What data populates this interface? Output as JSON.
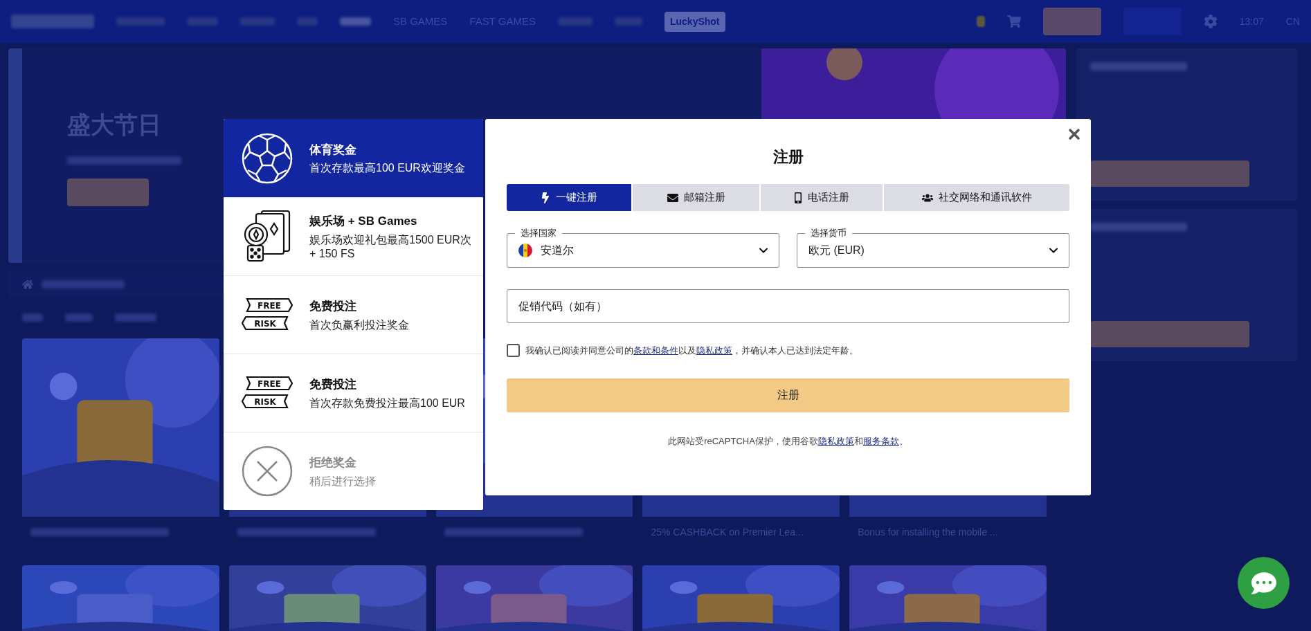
{
  "nav": {
    "items": [
      "SB GAMES",
      "FAST GAMES"
    ],
    "badge": "LuckyShot",
    "time": "13:07",
    "language": "CN"
  },
  "banner": {
    "title": "盛大节日"
  },
  "promo_cards": [
    {
      "kind": "blurred"
    },
    {
      "kind": "blurred"
    },
    {
      "kind": "blurred"
    },
    {
      "kind": "caption",
      "caption": "25% CASHBACK on Premier Lea..."
    },
    {
      "kind": "caption",
      "caption": "Bonus for installing the mobile ..."
    }
  ],
  "bonuses": [
    {
      "kind": "sport",
      "title": "体育奖金",
      "description": "首次存款最高100 EUR欢迎奖金",
      "selected": true
    },
    {
      "kind": "casino",
      "title": "娱乐场 + SB Games",
      "description": "娱乐场欢迎礼包最高1500 EUR次 + 150 FS",
      "selected": false
    },
    {
      "kind": "freerisk",
      "badge": [
        "FREE",
        "RISK"
      ],
      "title": "免费投注",
      "description": "首次负赢利投注奖金",
      "selected": false
    },
    {
      "kind": "freerisk",
      "badge": [
        "FREE",
        "RISK"
      ],
      "title": "免费投注",
      "description": "首次存款免费投注最高100 EUR",
      "selected": false
    },
    {
      "kind": "decline",
      "title": "拒绝奖金",
      "description": "稍后进行选择",
      "selected": false
    }
  ],
  "register": {
    "title": "注册",
    "tabs": [
      {
        "kind": "oneclick",
        "label": "一键注册",
        "selected": true
      },
      {
        "kind": "email",
        "label": "邮箱注册",
        "selected": false
      },
      {
        "kind": "phone",
        "label": "电话注册",
        "selected": false
      },
      {
        "kind": "social",
        "label": "社交网络和通讯软件",
        "selected": false
      }
    ],
    "country": {
      "label": "选择国家",
      "value": "安道尔"
    },
    "currency": {
      "label": "选择货币",
      "value": "欧元 (EUR)"
    },
    "promo_code": {
      "placeholder": "促销代码（如有）"
    },
    "consent": {
      "checked": false,
      "before": "我确认已阅读并同意公司的",
      "link1": "条款和条件",
      "middle": "以及",
      "link2": "隐私政策",
      "after": "，并确认本人已达到法定年龄。"
    },
    "submit": "注册",
    "note": {
      "before": "此网站受reCAPTCHA保护，使用谷歌",
      "link1": "隐私政策",
      "middle": "和",
      "link2": "服务条款",
      "after": "。"
    }
  }
}
